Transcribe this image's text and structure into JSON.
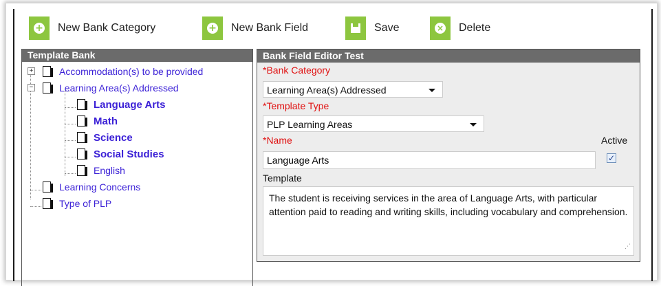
{
  "toolbar": {
    "new_category": "New Bank Category",
    "new_field": "New Bank Field",
    "save": "Save",
    "delete": "Delete"
  },
  "template_bank": {
    "header": "Template Bank",
    "items": [
      {
        "label": "Accommodation(s) to be provided"
      },
      {
        "label": "Learning Area(s) Addressed",
        "children": [
          {
            "label": "Language Arts"
          },
          {
            "label": "Math"
          },
          {
            "label": "Science"
          },
          {
            "label": "Social Studies"
          },
          {
            "label": "English"
          }
        ]
      },
      {
        "label": "Learning Concerns"
      },
      {
        "label": "Type of PLP"
      }
    ]
  },
  "editor": {
    "header": "Bank Field Editor Test",
    "bank_category_label": "*Bank Category",
    "bank_category_value": "Learning Area(s) Addressed",
    "template_type_label": "*Template Type",
    "template_type_value": "PLP Learning Areas",
    "name_label": "*Name",
    "name_value": "Language Arts",
    "active_label": "Active",
    "active_checked": true,
    "template_label": "Template",
    "template_value": "The student is receiving services in the area of Language Arts, with particular attention paid to reading and writing skills, including vocabulary and comprehension."
  },
  "colors": {
    "accent_green": "#8dc63f",
    "header_gray": "#6b6b6b",
    "link_blue": "#3a1fd6",
    "required_red": "#e01010"
  }
}
